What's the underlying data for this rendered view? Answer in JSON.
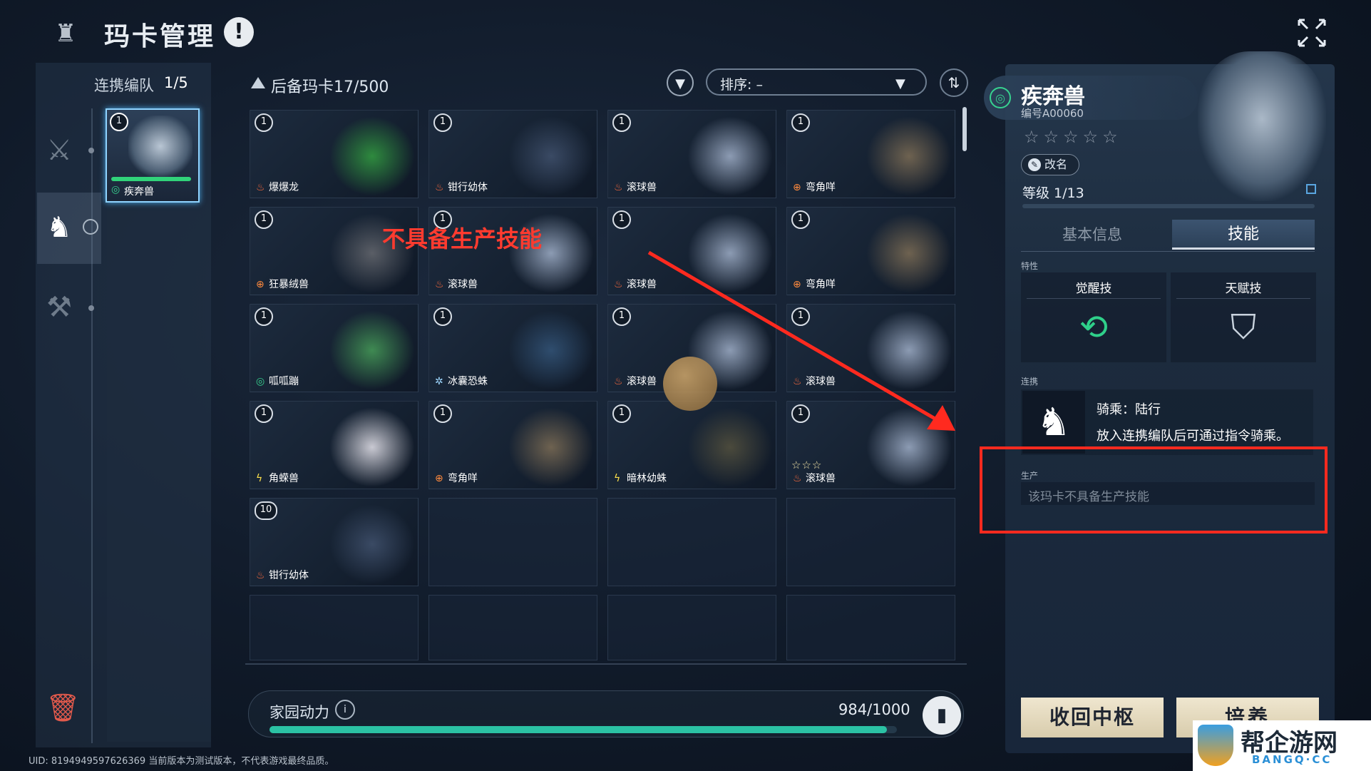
{
  "header": {
    "title": "玛卡管理",
    "warn_symbol": "!",
    "emblem_icon": "emblem-icon",
    "close_icon": "close-icon"
  },
  "team": {
    "label": "连携编队",
    "count": "1/5",
    "slot": {
      "name": "疾奔兽",
      "level_badge": "1"
    },
    "side_icons": [
      "combat-sword-icon",
      "riding-horse-icon",
      "gathering-axe-icon"
    ]
  },
  "reserve": {
    "title": "后备玛卡17/500",
    "sort_label": "排序: –",
    "cards": [
      {
        "level": "1",
        "element": "fire",
        "element_glyph": "♨",
        "element_color": "#ff6b3d",
        "name": "爆爆龙",
        "art": "#2e8a3e"
      },
      {
        "level": "1",
        "element": "fire",
        "element_glyph": "♨",
        "element_color": "#ff6b3d",
        "name": "钳行幼体",
        "art": "#3a4a64"
      },
      {
        "level": "1",
        "element": "fire",
        "element_glyph": "♨",
        "element_color": "#ff6b3d",
        "name": "滚球兽",
        "art": "#8c9bb3"
      },
      {
        "level": "1",
        "element": "earth",
        "element_glyph": "⊕",
        "element_color": "#ff8a3d",
        "name": "弯角咩",
        "art": "#6e6250"
      },
      {
        "level": "1",
        "element": "earth",
        "element_glyph": "⊕",
        "element_color": "#ff8a3d",
        "name": "狂暴绒兽",
        "art": "#5a5e66"
      },
      {
        "level": "1",
        "element": "fire",
        "element_glyph": "♨",
        "element_color": "#ff6b3d",
        "name": "滚球兽",
        "art": "#8c9bb3"
      },
      {
        "level": "1",
        "element": "fire",
        "element_glyph": "♨",
        "element_color": "#ff6b3d",
        "name": "滚球兽",
        "art": "#8c9bb3"
      },
      {
        "level": "1",
        "element": "earth",
        "element_glyph": "⊕",
        "element_color": "#ff8a3d",
        "name": "弯角咩",
        "art": "#6e6250"
      },
      {
        "level": "1",
        "element": "wind",
        "element_glyph": "◎",
        "element_color": "#37d28f",
        "name": "呱呱蹦",
        "art": "#3f8a52"
      },
      {
        "level": "1",
        "element": "ice",
        "element_glyph": "✲",
        "element_color": "#9fd8ff",
        "name": "冰囊恐蛛",
        "art": "#2f4d6e"
      },
      {
        "level": "1",
        "element": "fire",
        "element_glyph": "♨",
        "element_color": "#ff6b3d",
        "name": "滚球兽",
        "art": "#8c9bb3"
      },
      {
        "level": "1",
        "element": "fire",
        "element_glyph": "♨",
        "element_color": "#ff6b3d",
        "name": "滚球兽",
        "art": "#8c9bb3"
      },
      {
        "level": "1",
        "element": "thunder",
        "element_glyph": "ϟ",
        "element_color": "#ffe14a",
        "name": "角蝾兽",
        "art": "#c9c9d2"
      },
      {
        "level": "1",
        "element": "earth",
        "element_glyph": "⊕",
        "element_color": "#ff8a3d",
        "name": "弯角咩",
        "art": "#6e6250"
      },
      {
        "level": "1",
        "element": "thunder",
        "element_glyph": "ϟ",
        "element_color": "#ffe14a",
        "name": "暗林幼蛛",
        "art": "#4b4a3c"
      },
      {
        "level": "1",
        "element": "fire",
        "element_glyph": "♨",
        "element_color": "#ff6b3d",
        "name": "滚球兽",
        "art": "#8c9bb3",
        "stars": "☆☆☆"
      },
      {
        "level": "10",
        "element": "fire",
        "element_glyph": "♨",
        "element_color": "#ff6b3d",
        "name": "钳行幼体",
        "art": "#3a4a64"
      }
    ],
    "overlay_note": "不具备生产技能"
  },
  "home": {
    "label": "家园动力",
    "value": "984/1000",
    "current": 984,
    "max": 1000
  },
  "uid_text": "UID: 8194949597626369 当前版本为测试版本，不代表游戏最终品质。",
  "detail": {
    "name": "疾奔兽",
    "id": "编号A00060",
    "stars": "☆☆☆☆☆",
    "rename": "改名",
    "level": "等级 1/13",
    "tabs": {
      "basic": "基本信息",
      "skill": "技能"
    },
    "trait_label": "特性",
    "awaken": {
      "title": "觉醒技",
      "icon": "awaken-swirl-icon"
    },
    "talent": {
      "title": "天赋技",
      "icon": "talent-shield-icon"
    },
    "link_label": "连携",
    "link_title": "骑乘：陆行",
    "link_desc": "放入连携编队后可通过指令骑乘。",
    "prod_label": "生产",
    "prod_text": "该玛卡不具备生产技能"
  },
  "buttons": {
    "recall": "收回中枢",
    "train": "培养"
  },
  "watermark": {
    "main": "帮企游网",
    "sub": "BANGQ·CC"
  },
  "colors": {
    "accent_green": "#2bc2a4",
    "annotation_red": "#ff2a1f",
    "wind_green": "#37d28f"
  }
}
